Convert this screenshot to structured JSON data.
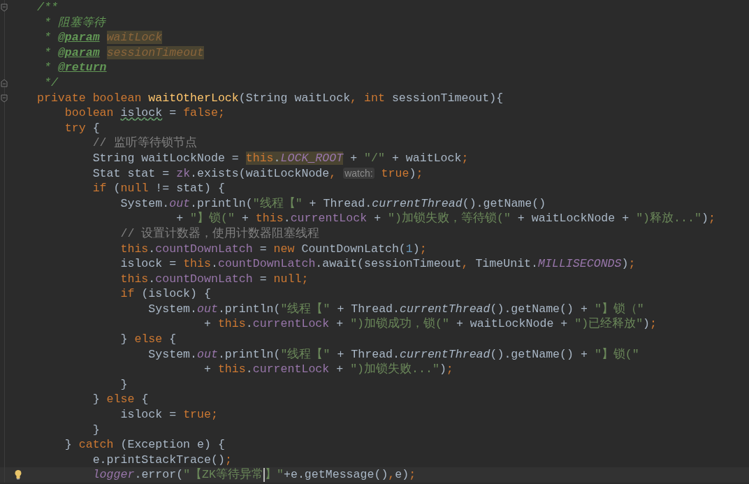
{
  "editor": {
    "lines": [
      {
        "fold_open": true,
        "tokens": [
          {
            "text": "/**",
            "kind": "doc"
          }
        ]
      },
      {
        "tokens": [
          {
            "text": " * 阻塞等待",
            "kind": "doc"
          }
        ]
      },
      {
        "tokens": [
          {
            "text": " * ",
            "kind": "doc"
          },
          {
            "text": "@param",
            "kind": "doctag"
          },
          {
            "text": "waitLock",
            "kind": "docparam"
          }
        ]
      },
      {
        "tokens": [
          {
            "text": " * ",
            "kind": "doc"
          },
          {
            "text": "@param",
            "kind": "doctag"
          },
          {
            "text": "sessionTimeout",
            "kind": "docparam"
          }
        ]
      },
      {
        "tokens": [
          {
            "text": " * ",
            "kind": "doc"
          },
          {
            "text": "@return",
            "kind": "doctag"
          }
        ]
      },
      {
        "fold_close": true,
        "tokens": [
          {
            "text": " */",
            "kind": "doc"
          }
        ]
      },
      {
        "fold_open": true,
        "tokens": [
          {
            "text": "private boolean ",
            "kind": "keyword"
          },
          {
            "text": "waitOtherLock",
            "kind": "method_decl"
          },
          {
            "text": "(String waitLock",
            "kind": "plain"
          },
          {
            "text": ", ",
            "kind": "keyword"
          },
          {
            "text": "int ",
            "kind": "keyword"
          },
          {
            "text": "sessionTimeout){",
            "kind": "plain"
          }
        ]
      },
      {
        "tokens": [
          {
            "text": "    boolean ",
            "kind": "keyword"
          },
          {
            "text": "islock",
            "kind": "typo"
          },
          {
            "text": " = ",
            "kind": "plain"
          },
          {
            "text": "false;",
            "kind": "keyword"
          }
        ]
      },
      {
        "tokens": [
          {
            "text": "    try",
            "kind": "keyword"
          },
          {
            "text": " {",
            "kind": "plain"
          }
        ]
      },
      {
        "tokens": [
          {
            "text": "        // 监听等待锁节点",
            "kind": "comment"
          }
        ]
      },
      {
        "tokens": [
          {
            "text": "        String waitLockNode = ",
            "kind": "plain"
          },
          {
            "text": "this",
            "kind": "keyword_hl"
          },
          {
            "text": ".",
            "kind": "plain_hl"
          },
          {
            "text": "LOCK_ROOT",
            "kind": "static_hl"
          },
          {
            "text": " + ",
            "kind": "plain"
          },
          {
            "text": "\"/\"",
            "kind": "string"
          },
          {
            "text": " + waitLock",
            "kind": "plain"
          },
          {
            "text": ";",
            "kind": "keyword"
          }
        ]
      },
      {
        "tokens": [
          {
            "text": "        Stat stat = ",
            "kind": "plain"
          },
          {
            "text": "zk",
            "kind": "field"
          },
          {
            "text": ".exists(waitLockNode",
            "kind": "plain"
          },
          {
            "text": ", ",
            "kind": "keyword"
          },
          {
            "text": "watch:",
            "kind": "hint"
          },
          {
            "text": " true",
            "kind": "keyword"
          },
          {
            "text": ")",
            "kind": "plain"
          },
          {
            "text": ";",
            "kind": "keyword"
          }
        ]
      },
      {
        "tokens": [
          {
            "text": "        if ",
            "kind": "keyword"
          },
          {
            "text": "(",
            "kind": "plain"
          },
          {
            "text": "null ",
            "kind": "keyword"
          },
          {
            "text": "!= stat) {",
            "kind": "plain"
          }
        ]
      },
      {
        "tokens": [
          {
            "text": "            System.",
            "kind": "plain"
          },
          {
            "text": "out",
            "kind": "static"
          },
          {
            "text": ".println(",
            "kind": "plain"
          },
          {
            "text": "\"线程【\"",
            "kind": "string"
          },
          {
            "text": " + Thread.",
            "kind": "plain"
          },
          {
            "text": "currentThread",
            "kind": "static_method"
          },
          {
            "text": "().getName()",
            "kind": "plain"
          }
        ]
      },
      {
        "tokens": [
          {
            "text": "                    + ",
            "kind": "plain"
          },
          {
            "text": "\"】锁(\"",
            "kind": "string"
          },
          {
            "text": " + ",
            "kind": "plain"
          },
          {
            "text": "this",
            "kind": "keyword"
          },
          {
            "text": ".",
            "kind": "plain"
          },
          {
            "text": "currentLock",
            "kind": "field"
          },
          {
            "text": " + ",
            "kind": "plain"
          },
          {
            "text": "\")加锁失败，等待锁(\"",
            "kind": "string"
          },
          {
            "text": " + waitLockNode + ",
            "kind": "plain"
          },
          {
            "text": "\")释放...\"",
            "kind": "string"
          },
          {
            "text": ")",
            "kind": "plain"
          },
          {
            "text": ";",
            "kind": "keyword"
          }
        ]
      },
      {
        "tokens": [
          {
            "text": "            // 设置计数器，使用计数器阻塞线程",
            "kind": "comment"
          }
        ]
      },
      {
        "tokens": [
          {
            "text": "            this",
            "kind": "keyword"
          },
          {
            "text": ".",
            "kind": "plain"
          },
          {
            "text": "countDownLatch",
            "kind": "field"
          },
          {
            "text": " = ",
            "kind": "plain"
          },
          {
            "text": "new ",
            "kind": "keyword"
          },
          {
            "text": "CountDownLatch(",
            "kind": "plain"
          },
          {
            "text": "1",
            "kind": "number"
          },
          {
            "text": ")",
            "kind": "plain"
          },
          {
            "text": ";",
            "kind": "keyword"
          }
        ]
      },
      {
        "tokens": [
          {
            "text": "            islock = ",
            "kind": "plain"
          },
          {
            "text": "this",
            "kind": "keyword"
          },
          {
            "text": ".",
            "kind": "plain"
          },
          {
            "text": "countDownLatch",
            "kind": "field"
          },
          {
            "text": ".await(sessionTimeout",
            "kind": "plain"
          },
          {
            "text": ", ",
            "kind": "keyword"
          },
          {
            "text": "TimeUnit.",
            "kind": "plain"
          },
          {
            "text": "MILLISECONDS",
            "kind": "static"
          },
          {
            "text": ")",
            "kind": "plain"
          },
          {
            "text": ";",
            "kind": "keyword"
          }
        ]
      },
      {
        "tokens": [
          {
            "text": "            this",
            "kind": "keyword"
          },
          {
            "text": ".",
            "kind": "plain"
          },
          {
            "text": "countDownLatch",
            "kind": "field"
          },
          {
            "text": " = ",
            "kind": "plain"
          },
          {
            "text": "null;",
            "kind": "keyword"
          }
        ]
      },
      {
        "tokens": [
          {
            "text": "            if ",
            "kind": "keyword"
          },
          {
            "text": "(islock) {",
            "kind": "plain"
          }
        ]
      },
      {
        "tokens": [
          {
            "text": "                System.",
            "kind": "plain"
          },
          {
            "text": "out",
            "kind": "static"
          },
          {
            "text": ".println(",
            "kind": "plain"
          },
          {
            "text": "\"线程【\"",
            "kind": "string"
          },
          {
            "text": " + Thread.",
            "kind": "plain"
          },
          {
            "text": "currentThread",
            "kind": "static_method"
          },
          {
            "text": "().getName() + ",
            "kind": "plain"
          },
          {
            "text": "\"】锁（\"",
            "kind": "string"
          }
        ]
      },
      {
        "tokens": [
          {
            "text": "                        + ",
            "kind": "plain"
          },
          {
            "text": "this",
            "kind": "keyword"
          },
          {
            "text": ".",
            "kind": "plain"
          },
          {
            "text": "currentLock",
            "kind": "field"
          },
          {
            "text": " + ",
            "kind": "plain"
          },
          {
            "text": "\")加锁成功，锁(\"",
            "kind": "string"
          },
          {
            "text": " + waitLockNode + ",
            "kind": "plain"
          },
          {
            "text": "\")已经释放\"",
            "kind": "string"
          },
          {
            "text": ")",
            "kind": "plain"
          },
          {
            "text": ";",
            "kind": "keyword"
          }
        ]
      },
      {
        "tokens": [
          {
            "text": "            } ",
            "kind": "plain"
          },
          {
            "text": "else",
            "kind": "keyword"
          },
          {
            "text": " {",
            "kind": "plain"
          }
        ]
      },
      {
        "tokens": [
          {
            "text": "                System.",
            "kind": "plain"
          },
          {
            "text": "out",
            "kind": "static"
          },
          {
            "text": ".println(",
            "kind": "plain"
          },
          {
            "text": "\"线程【\"",
            "kind": "string"
          },
          {
            "text": " + Thread.",
            "kind": "plain"
          },
          {
            "text": "currentThread",
            "kind": "static_method"
          },
          {
            "text": "().getName() + ",
            "kind": "plain"
          },
          {
            "text": "\"】锁(\"",
            "kind": "string"
          }
        ]
      },
      {
        "tokens": [
          {
            "text": "                        + ",
            "kind": "plain"
          },
          {
            "text": "this",
            "kind": "keyword"
          },
          {
            "text": ".",
            "kind": "plain"
          },
          {
            "text": "currentLock",
            "kind": "field"
          },
          {
            "text": " + ",
            "kind": "plain"
          },
          {
            "text": "\")加锁失败...\"",
            "kind": "string"
          },
          {
            "text": ")",
            "kind": "plain"
          },
          {
            "text": ";",
            "kind": "keyword"
          }
        ]
      },
      {
        "tokens": [
          {
            "text": "            }",
            "kind": "plain"
          }
        ]
      },
      {
        "tokens": [
          {
            "text": "        } ",
            "kind": "plain"
          },
          {
            "text": "else",
            "kind": "keyword"
          },
          {
            "text": " {",
            "kind": "plain"
          }
        ]
      },
      {
        "tokens": [
          {
            "text": "            islock = ",
            "kind": "plain"
          },
          {
            "text": "true;",
            "kind": "keyword"
          }
        ]
      },
      {
        "tokens": [
          {
            "text": "        }",
            "kind": "plain"
          }
        ]
      },
      {
        "tokens": [
          {
            "text": "    } ",
            "kind": "plain"
          },
          {
            "text": "catch ",
            "kind": "keyword"
          },
          {
            "text": "(Exception e) {",
            "kind": "plain"
          }
        ]
      },
      {
        "tokens": [
          {
            "text": "        e.printStackTrace()",
            "kind": "plain"
          },
          {
            "text": ";",
            "kind": "keyword"
          }
        ]
      },
      {
        "current": true,
        "intention_bulb": true,
        "tokens": [
          {
            "text": "        logger",
            "kind": "static"
          },
          {
            "text": ".error(",
            "kind": "plain"
          },
          {
            "text": "\"【ZK等待异常",
            "kind": "string",
            "caret": true
          },
          {
            "text": "】\"",
            "kind": "string"
          },
          {
            "text": "+e.getMessage()",
            "kind": "plain"
          },
          {
            "text": ",",
            "kind": "keyword"
          },
          {
            "text": "e)",
            "kind": "plain"
          },
          {
            "text": ";",
            "kind": "keyword"
          }
        ]
      }
    ]
  }
}
